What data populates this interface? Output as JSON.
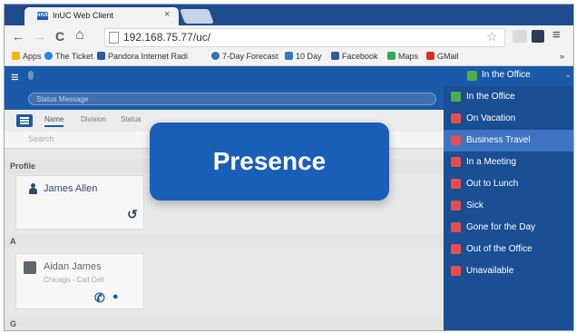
{
  "browser": {
    "tab_title": "InUC Web Client",
    "tab_close": "×",
    "favicon_text": "InUC",
    "url": "192.168.75.77/uc/",
    "back_glyph": "←",
    "forward_glyph": "→",
    "reload_glyph": "C",
    "home_glyph": "⌂",
    "star_glyph": "☆",
    "menu_glyph": "≡",
    "bookmarks": [
      {
        "label": "Apps",
        "icon": "apps-grid-icon",
        "color": "#f4b400"
      },
      {
        "label": "The Ticket",
        "icon": "ticket-icon",
        "color": "#1e88e5"
      },
      {
        "label": "Pandora Internet Radi",
        "icon": "pandora-icon",
        "color": "#2b5a9e"
      },
      {
        "label": "7-Day Forecast",
        "icon": "weather-icon",
        "color": "#3b6fbf"
      },
      {
        "label": "10 Day",
        "icon": "calendar-icon",
        "color": "#3a73c5"
      },
      {
        "label": "Facebook",
        "icon": "facebook-icon",
        "color": "#3b5998"
      },
      {
        "label": "Maps",
        "icon": "maps-icon",
        "color": "#34a853"
      },
      {
        "label": "GMail",
        "icon": "gmail-icon",
        "color": "#d93025"
      }
    ],
    "bookmarks_more": "»"
  },
  "app": {
    "hamburger_glyph": "≡",
    "status_message_placeholder": "Status Message",
    "subtabs": [
      "Name",
      "Division",
      "Status"
    ],
    "search_placeholder": "Search",
    "presence_button_label": "In the Office",
    "presence_chevron": "⌄"
  },
  "directory": {
    "profile_header": "Profile",
    "profile_name": "James Allen",
    "section_a": "A",
    "contact_name": "Aidan James",
    "contact_detail": "Chicago - Call Cell",
    "section_g": "G",
    "history_glyph": "↺",
    "phone_glyph": "✆",
    "chat_glyph": "●"
  },
  "overlay": {
    "text": "Presence"
  },
  "presence_menu": [
    {
      "label": "In the Office",
      "color": "#49b04a",
      "icon": "office-icon",
      "hover": false
    },
    {
      "label": "On Vacation",
      "color": "#e84c4c",
      "icon": "vacation-icon",
      "hover": false
    },
    {
      "label": "Business Travel",
      "color": "#e84c4c",
      "icon": "airplane-icon",
      "hover": true
    },
    {
      "label": "In a Meeting",
      "color": "#e84c4c",
      "icon": "meeting-icon",
      "hover": false
    },
    {
      "label": "Out to Lunch",
      "color": "#e84c4c",
      "icon": "lunch-icon",
      "hover": false
    },
    {
      "label": "Sick",
      "color": "#e84c4c",
      "icon": "sick-icon",
      "hover": false
    },
    {
      "label": "Gone for the Day",
      "color": "#e84c4c",
      "icon": "gone-icon",
      "hover": false
    },
    {
      "label": "Out of the Office",
      "color": "#e84c4c",
      "icon": "out-of-office-icon",
      "hover": false
    },
    {
      "label": "Unavailable",
      "color": "#e84c4c",
      "icon": "unavailable-icon",
      "hover": false
    }
  ]
}
